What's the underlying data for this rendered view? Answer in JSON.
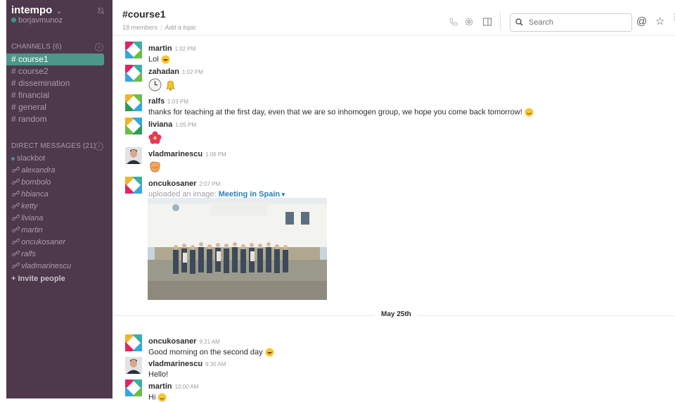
{
  "team": {
    "name": "intempo",
    "user": "borjavmunoz"
  },
  "channels": {
    "title": "CHANNELS",
    "count": "(6)",
    "items": [
      {
        "label": "# course1"
      },
      {
        "label": "# course2"
      },
      {
        "label": "# dissemination"
      },
      {
        "label": "# financial"
      },
      {
        "label": "# general"
      },
      {
        "label": "# random"
      }
    ]
  },
  "dms": {
    "title": "DIRECT MESSAGES",
    "count": "(21)",
    "items": [
      {
        "label": "slackbot"
      },
      {
        "label": "alexandra"
      },
      {
        "label": "bombolo"
      },
      {
        "label": "hbianca"
      },
      {
        "label": "ketty"
      },
      {
        "label": "liviana"
      },
      {
        "label": "martin"
      },
      {
        "label": "oncukosaner"
      },
      {
        "label": "ralfs"
      },
      {
        "label": "vladmarinescu"
      }
    ],
    "invite": "+ Invite people"
  },
  "header": {
    "channel": "#course1",
    "members": "18 members",
    "topic": "Add a topic",
    "search_placeholder": "Search"
  },
  "messages": [
    {
      "author": "martin",
      "time": "1:02 PM",
      "text": "Lol"
    },
    {
      "author": "zahadan",
      "time": "1:02 PM",
      "text": ""
    },
    {
      "author": "ralfs",
      "time": "1:03 PM",
      "text": "thanks for teaching at the first day, even that we are so inhomogen group, we hope you come back tomorrow!"
    },
    {
      "author": "liviana",
      "time": "1:05 PM",
      "text": ""
    },
    {
      "author": "vladmarinescu",
      "time": "1:06 PM",
      "text": ""
    },
    {
      "author": "oncukosaner",
      "time": "2:07 PM",
      "sub": "uploaded an image:",
      "link": "Meeting in Spain"
    },
    {
      "author": "oncukosaner",
      "time": "9:21 AM",
      "text": "Good morning on the second day"
    },
    {
      "author": "vladmarinescu",
      "time": "9:30 AM",
      "text": "Hello!"
    },
    {
      "author": "martin",
      "time": "10:00 AM",
      "text": "Hi"
    }
  ],
  "divider": "May 25th",
  "colors": {
    "sidebar": "#4d394b",
    "active_channel": "#4c9689",
    "link": "#2a80b9"
  }
}
